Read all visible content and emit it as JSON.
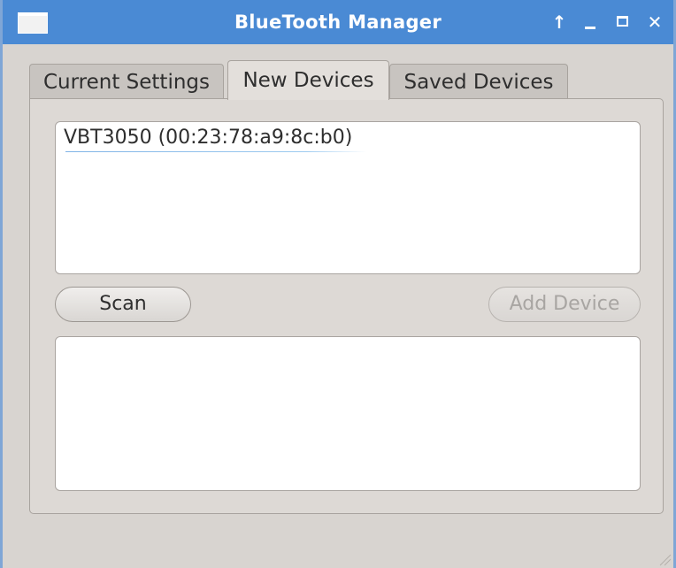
{
  "window": {
    "title": "BlueTooth Manager",
    "controls": {
      "up": "↑",
      "close": "✕"
    }
  },
  "tabs": [
    {
      "label": "Current Settings",
      "active": false
    },
    {
      "label": "New Devices",
      "active": true
    },
    {
      "label": "Saved Devices",
      "active": false
    }
  ],
  "new_devices": {
    "devices": [
      {
        "label": "VBT3050 (00:23:78:a9:8c:b0)"
      }
    ],
    "scan_label": "Scan",
    "add_device_label": "Add Device",
    "add_device_enabled": false
  },
  "colors": {
    "titlebar": "#4a8ad4",
    "window_bg": "#d8d4d0",
    "disabled_text": "#a8a5a2"
  }
}
